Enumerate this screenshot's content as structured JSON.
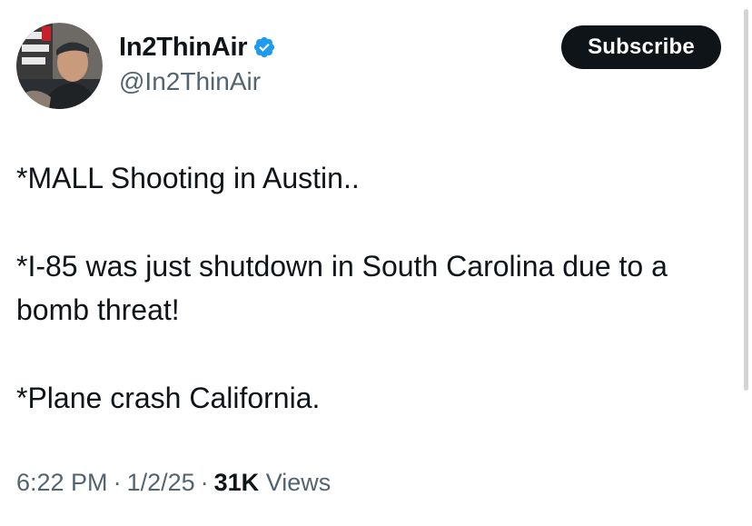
{
  "author": {
    "display_name": "In2ThinAir",
    "handle": "@In2ThinAir",
    "verified": true,
    "verified_color": "#1d9bf0",
    "avatar_icon": "profile-photo"
  },
  "actions": {
    "subscribe_label": "Subscribe"
  },
  "tweet": {
    "lines": [
      "*MALL Shooting in Austin..",
      "*I-85 was just shutdown in South Carolina due to a bomb threat!",
      "*Plane crash California."
    ]
  },
  "meta": {
    "time": "6:22 PM",
    "date": "1/2/25",
    "separator": "·",
    "views_count": "31K",
    "views_label": "Views"
  },
  "colors": {
    "text": "#0f1419",
    "secondary": "#536471",
    "button_bg": "#0f1419"
  }
}
